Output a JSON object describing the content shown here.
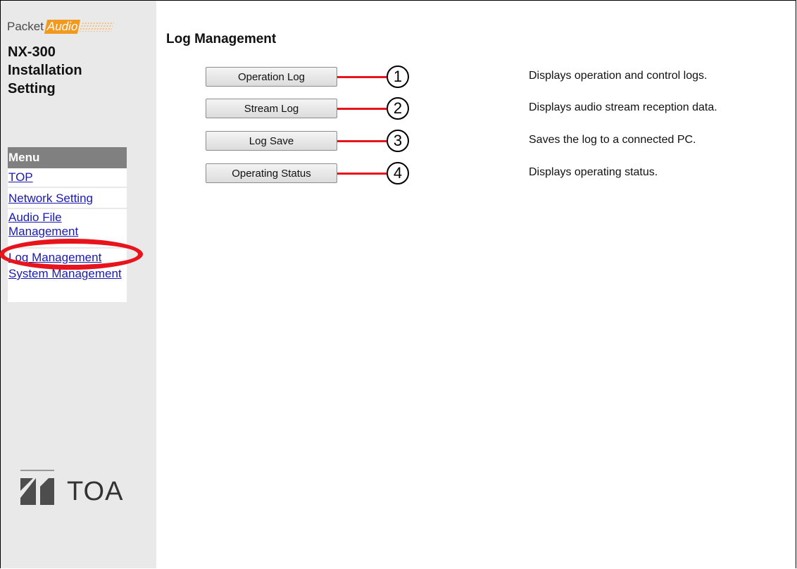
{
  "brand": {
    "packet": "Packet",
    "audio": "Audio",
    "maker": "TOA"
  },
  "product": {
    "line1": "NX-300",
    "line2": "Installation",
    "line3": "Setting"
  },
  "menu": {
    "header": "Menu",
    "items": [
      {
        "label": "TOP"
      },
      {
        "label": "Network Setting"
      },
      {
        "label": "Audio File Management"
      },
      {
        "label": "Log Management"
      },
      {
        "label": "System Management"
      }
    ]
  },
  "main": {
    "title": "Log Management",
    "rows": [
      {
        "button": "Operation Log",
        "marker": "1",
        "description": "Displays operation and control logs."
      },
      {
        "button": "Stream Log",
        "marker": "2",
        "description": "Displays audio stream reception data."
      },
      {
        "button": "Log Save",
        "marker": "3",
        "description": "Saves the log to a connected PC."
      },
      {
        "button": "Operating Status",
        "marker": "4",
        "description": "Displays operating status."
      }
    ]
  },
  "colors": {
    "highlight": "#e8131b",
    "brand_accent": "#f39a1e",
    "menu_header": "#808080",
    "link": "#1a1ab0"
  }
}
